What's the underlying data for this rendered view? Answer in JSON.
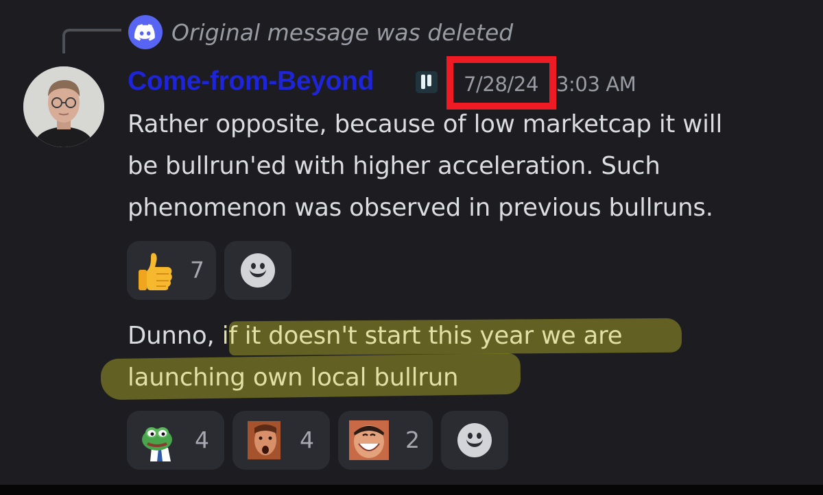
{
  "reply": {
    "icon": "discord-icon",
    "text": "Original message was deleted"
  },
  "message": {
    "author": "Come-from-Beyond",
    "author_color": "#1e24d8",
    "tag_icon": "server-tag-icon",
    "date": "7/28/24",
    "time": "3:03 AM",
    "date_highlight_color": "#ee1b24",
    "lines": [
      "Rather opposite, because of low marketcap it will",
      "be bullrun'ed with higher acceleration. Such",
      "phenomenon was observed in previous bullruns."
    ],
    "reactions": [
      {
        "emoji": "thumbs-up-icon",
        "count": "7"
      }
    ],
    "add_reaction_icon": "add-reaction-icon"
  },
  "followup": {
    "line1_prefix": "Dunno, ",
    "line1_highlighted": "if it doesn't start this year we are",
    "line2_highlighted": "launching own local bullrun",
    "highlight_color": "#d6d228",
    "reactions": [
      {
        "emoji": "pepe-businessman-emoji",
        "count": "4"
      },
      {
        "emoji": "shocked-face-emoji",
        "count": "4"
      },
      {
        "emoji": "grinning-man-emoji",
        "count": "2"
      }
    ],
    "add_reaction_icon": "add-reaction-icon"
  }
}
